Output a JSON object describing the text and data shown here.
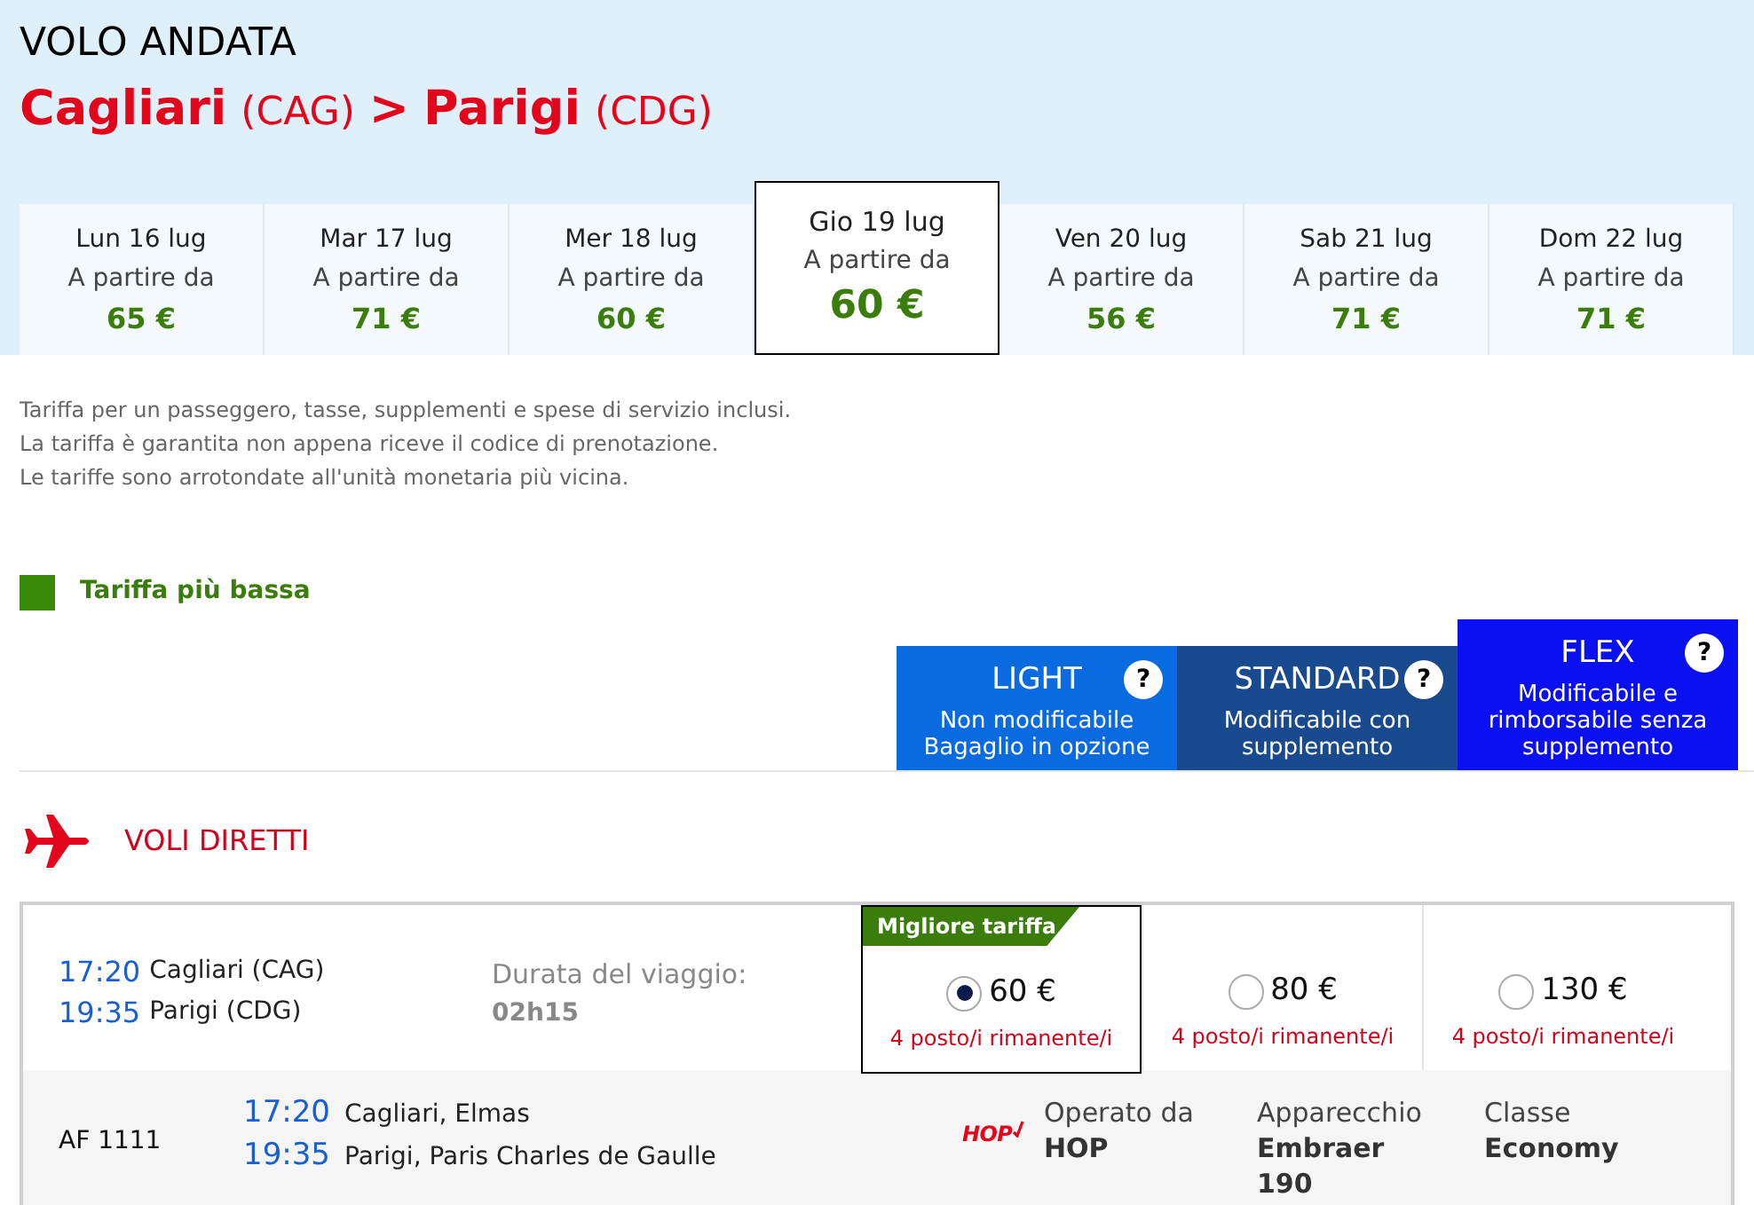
{
  "header": {
    "title": "VOLO ANDATA",
    "origin": {
      "city": "Cagliari",
      "code": "(CAG)"
    },
    "separator": ">",
    "destination": {
      "city": "Parigi",
      "code": "(CDG)"
    }
  },
  "dates": [
    {
      "day": "Lun 16 lug",
      "from": "A partire da",
      "price": "65 €",
      "selected": false
    },
    {
      "day": "Mar 17 lug",
      "from": "A partire da",
      "price": "71 €",
      "selected": false
    },
    {
      "day": "Mer 18 lug",
      "from": "A partire da",
      "price": "60 €",
      "selected": false
    },
    {
      "day": "Gio 19 lug",
      "from": "A partire da",
      "price": "60 €",
      "selected": true
    },
    {
      "day": "Ven 20 lug",
      "from": "A partire da",
      "price": "56 €",
      "selected": false
    },
    {
      "day": "Sab 21 lug",
      "from": "A partire da",
      "price": "71 €",
      "selected": false
    },
    {
      "day": "Dom 22 lug",
      "from": "A partire da",
      "price": "71 €",
      "selected": false
    }
  ],
  "notes": [
    "Tariffa per un passeggero, tasse, supplementi e spese di servizio inclusi.",
    "La tariffa è garantita non appena riceve il codice di prenotazione.",
    "Le tariffe sono arrotondate all'unità monetaria più vicina."
  ],
  "legend": {
    "label": "Tariffa più bassa",
    "color": "#3a8a0a"
  },
  "fares": [
    {
      "name": "LIGHT",
      "help": "?",
      "description": [
        "Non modificabile",
        "Bagaglio in opzione"
      ],
      "color": "#0a6be0"
    },
    {
      "name": "STANDARD",
      "help": "?",
      "description": [
        "Modificabile con",
        "supplemento"
      ],
      "color": "#1a4a8e"
    },
    {
      "name": "FLEX",
      "help": "?",
      "description": [
        "Modificabile e",
        "rimborsabile senza",
        "supplemento"
      ],
      "color": "#0a10f0"
    }
  ],
  "section": "VOLI DIRETTI",
  "flight": {
    "departure_time": "17:20",
    "departure_place": "Cagliari (CAG)",
    "arrival_time": "19:35",
    "arrival_place": "Parigi (CDG)",
    "duration_label": "Durata del viaggio:",
    "duration": "02h15",
    "options": [
      {
        "badge": "Migliore tariffa",
        "price": "60 €",
        "seats": "4 posto/i rimanente/i",
        "selected": true
      },
      {
        "price": "80 €",
        "seats": "4 posto/i rimanente/i",
        "selected": false
      },
      {
        "price": "130 €",
        "seats": "4 posto/i rimanente/i",
        "selected": false
      }
    ],
    "details": {
      "number": "AF 1111",
      "departure_time": "17:20",
      "departure_airport": "Cagliari, Elmas",
      "arrival_time": "19:35",
      "arrival_airport": "Parigi, Paris Charles de Gaulle",
      "logo": "HOP",
      "operated_label": "Operato da",
      "operator": "HOP",
      "aircraft_label": "Apparecchio",
      "aircraft": [
        "Embraer",
        "190"
      ],
      "class_label": "Classe",
      "class": "Economy"
    }
  }
}
